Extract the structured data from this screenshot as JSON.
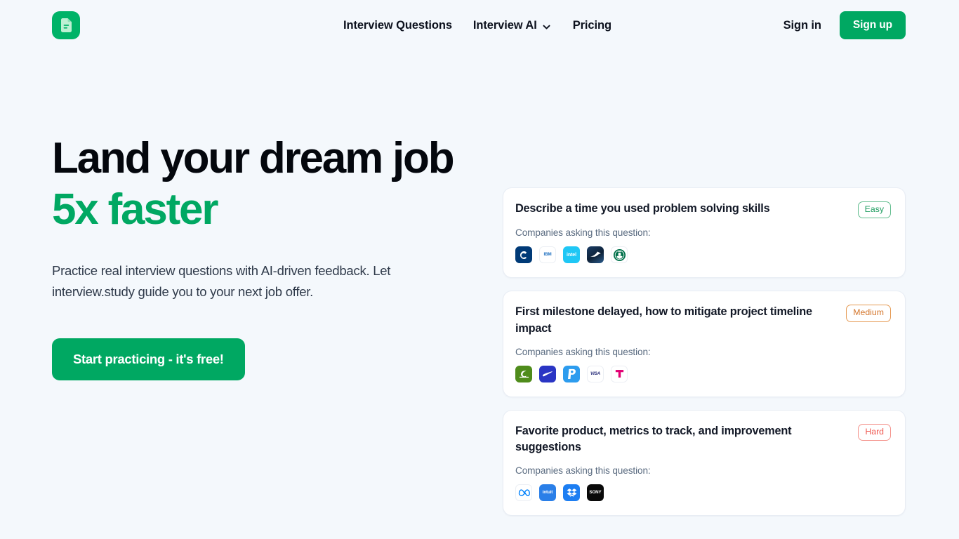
{
  "brand": {
    "logo_icon": "document-icon",
    "logo_bg": "#00b368"
  },
  "header": {
    "nav": [
      {
        "label": "Interview Questions",
        "has_dropdown": false
      },
      {
        "label": "Interview AI",
        "has_dropdown": true,
        "icon": "chevron-down-icon"
      },
      {
        "label": "Pricing",
        "has_dropdown": false
      }
    ],
    "signin_label": "Sign in",
    "signup_label": "Sign up",
    "signup_color": "#00a862"
  },
  "hero": {
    "headline_part1": "Land your dream job ",
    "headline_accent": "5x faster",
    "accent_color": "#00a862",
    "subtitle": "Practice real interview questions with AI-driven feedback. Let interview.study guide you to your next job offer.",
    "cta_label": "Start practicing - it's free!"
  },
  "cards_common": {
    "companies_label": "Companies asking this question:"
  },
  "cards": [
    {
      "title": "Describe a time you used problem solving skills",
      "difficulty": "Easy",
      "difficulty_class": "easy",
      "difficulty_color": "#1f9d60",
      "companies": [
        "Capital One",
        "IBM",
        "Intel",
        "Boeing",
        "Starbucks"
      ]
    },
    {
      "title": "First milestone delayed, how to mitigate project timeline impact",
      "difficulty": "Medium",
      "difficulty_class": "medium",
      "difficulty_color": "#d4752a",
      "companies": [
        "Nvidia",
        "Nike",
        "PayPal",
        "Visa",
        "T-Mobile"
      ]
    },
    {
      "title": "Favorite product, metrics to track, and improvement suggestions",
      "difficulty": "Hard",
      "difficulty_class": "hard",
      "difficulty_color": "#ef5a52",
      "companies": [
        "Meta",
        "Intuit",
        "Dropbox",
        "Sony"
      ]
    }
  ]
}
